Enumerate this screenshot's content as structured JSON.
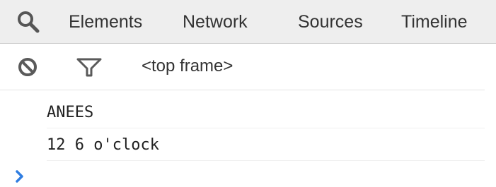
{
  "tabbar": {
    "search_icon": "search-icon",
    "tabs": [
      {
        "label": "Elements"
      },
      {
        "label": "Network"
      },
      {
        "label": "Sources"
      },
      {
        "label": "Timeline"
      }
    ]
  },
  "toolbar": {
    "clear_icon": "clear-console-icon",
    "filter_icon": "filter-icon",
    "frame_label": "<top frame>"
  },
  "console": {
    "messages": [
      {
        "text": "ANEES"
      },
      {
        "text": "12 6 o'clock"
      }
    ],
    "prompt_icon": "chevron-right-icon"
  },
  "colors": {
    "tabbar_bg": "#eeeeee",
    "prompt_blue": "#2f7de1",
    "icon_gray": "#5a5a5a"
  }
}
